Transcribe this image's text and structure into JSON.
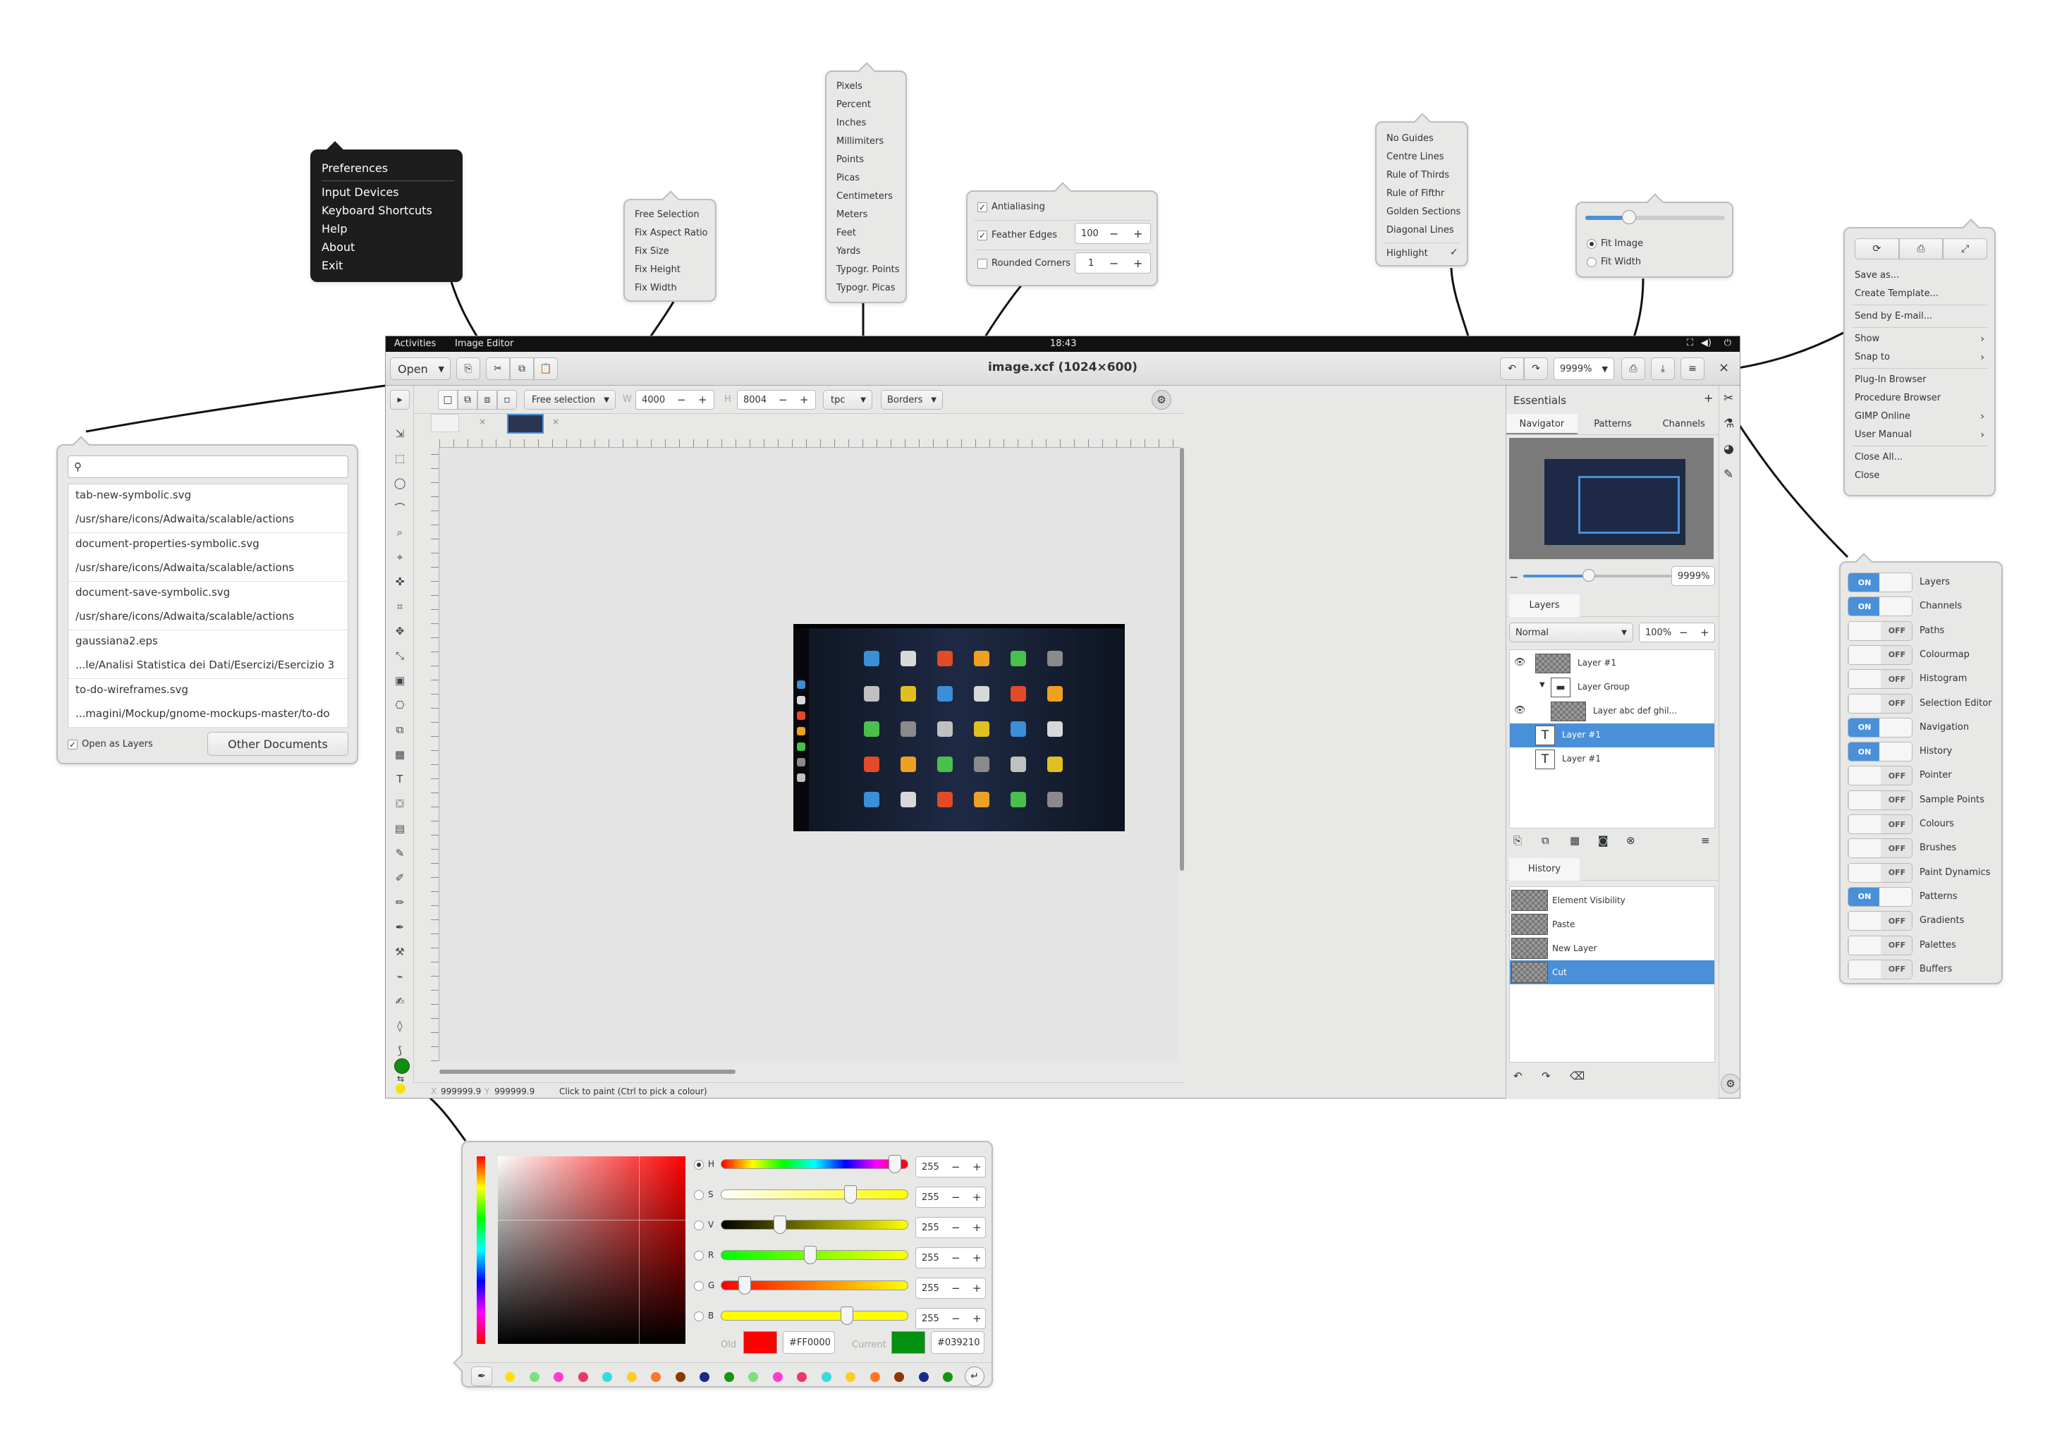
{
  "topbar": {
    "activities": "Activities",
    "app": "Image Editor",
    "clock": "18:43"
  },
  "titlebar": {
    "open_label": "Open",
    "title": "image.xcf (1024×600)",
    "zoom_value": "9999%"
  },
  "toolopts": {
    "selection_mode": "Free selection",
    "w_label": "W",
    "w_value": "4000",
    "h_label": "H",
    "h_value": "8004",
    "unit": "tpc",
    "borders": "Borders"
  },
  "app_menu": {
    "items": [
      "Preferences",
      "Input Devices",
      "Keyboard Shortcuts",
      "Help",
      "About",
      "Exit"
    ]
  },
  "selection_menu": {
    "items": [
      "Free Selection",
      "Fix Aspect Ratio",
      "Fix Size",
      "Fix Height",
      "Fix Width"
    ]
  },
  "unit_menu": {
    "items": [
      "Pixels",
      "Percent",
      "Inches",
      "Millimiters",
      "Points",
      "Picas",
      "Centimeters",
      "Meters",
      "Feet",
      "Yards",
      "Typogr. Points",
      "Typogr. Picas"
    ]
  },
  "borders_popover": {
    "antialiasing": "Antialiasing",
    "feather_label": "Feather Edges",
    "feather_value": "100",
    "rounded_label": "Rounded Corners",
    "rounded_value": "1"
  },
  "guides_menu": {
    "items": [
      "No Guides",
      "Centre Lines",
      "Rule of Thirds",
      "Rule of Fifthr",
      "Golden Sections",
      "Diagonal Lines"
    ],
    "highlight": "Highlight"
  },
  "zoom_popover": {
    "fit_image": "Fit Image",
    "fit_width": "Fit Width"
  },
  "image_menu": {
    "items": [
      "Save as...",
      "Create Template...",
      "Send by E-mail...",
      "Show",
      "Snap to",
      "Plug-In Browser",
      "Procedure Browser",
      "GIMP Online",
      "User Manual",
      "Close All...",
      "Close"
    ],
    "submenu_arrow": "›"
  },
  "docks_popover": {
    "on": "ON",
    "off": "OFF",
    "items": [
      {
        "label": "Layers",
        "state": "on"
      },
      {
        "label": "Channels",
        "state": "on"
      },
      {
        "label": "Paths",
        "state": "off"
      },
      {
        "label": "Colourmap",
        "state": "off"
      },
      {
        "label": "Histogram",
        "state": "off"
      },
      {
        "label": "Selection Editor",
        "state": "off"
      },
      {
        "label": "Navigation",
        "state": "on"
      },
      {
        "label": "History",
        "state": "on"
      },
      {
        "label": "Pointer",
        "state": "off"
      },
      {
        "label": "Sample Points",
        "state": "off"
      },
      {
        "label": "Colours",
        "state": "off"
      },
      {
        "label": "Brushes",
        "state": "off"
      },
      {
        "label": "Paint Dynamics",
        "state": "off"
      },
      {
        "label": "Patterns",
        "state": "on"
      },
      {
        "label": "Gradients",
        "state": "off"
      },
      {
        "label": "Palettes",
        "state": "off"
      },
      {
        "label": "Buffers",
        "state": "off"
      }
    ]
  },
  "open_popover": {
    "recent": [
      {
        "name": "tab-new-symbolic.svg",
        "path": "/usr/share/icons/Adwaita/scalable/actions"
      },
      {
        "name": "document-properties-symbolic.svg",
        "path": "/usr/share/icons/Adwaita/scalable/actions"
      },
      {
        "name": "document-save-symbolic.svg",
        "path": "/usr/share/icons/Adwaita/scalable/actions"
      },
      {
        "name": "gaussiana2.eps",
        "path": "...le/Analisi Statistica dei Dati/Esercizi/Esercizio 3"
      },
      {
        "name": "to-do-wireframes.svg",
        "path": "...magini/Mockup/gnome-mockups-master/to-do"
      }
    ],
    "open_as_layers": "Open as Layers",
    "other_documents": "Other Documents"
  },
  "dock": {
    "title": "Essentials",
    "tabs": [
      "Navigator",
      "Patterns",
      "Channels"
    ],
    "nav_zoom": "9999%",
    "layers_tab": "Layers",
    "blend_mode": "Normal",
    "opacity": "100%",
    "layers": [
      {
        "name": "Layer #1",
        "visible": true,
        "indent": 0,
        "type": "thumb",
        "selected": false
      },
      {
        "name": "Layer Group",
        "visible": false,
        "indent": 1,
        "type": "group",
        "selected": false
      },
      {
        "name": "Layer abc def ghil...",
        "visible": true,
        "indent": 1,
        "type": "thumb",
        "selected": false
      },
      {
        "name": "Layer #1",
        "visible": false,
        "indent": 0,
        "type": "text",
        "selected": true
      },
      {
        "name": "Layer #1",
        "visible": false,
        "indent": 0,
        "type": "text",
        "selected": false
      }
    ],
    "history_tab": "History",
    "history": [
      {
        "name": "Element Visibility",
        "selected": false
      },
      {
        "name": "Paste",
        "selected": false
      },
      {
        "name": "New Layer",
        "selected": false
      },
      {
        "name": "Cut",
        "selected": true
      }
    ]
  },
  "statusbar": {
    "x_label": "X",
    "x_value": "999999.9",
    "y_label": "Y",
    "y_value": "999999.9",
    "hint": "Click to paint (Ctrl to pick a colour)"
  },
  "color_popover": {
    "channels": [
      {
        "label": "H",
        "value": "255",
        "selected": true
      },
      {
        "label": "S",
        "value": "255",
        "selected": false
      },
      {
        "label": "V",
        "value": "255",
        "selected": false
      },
      {
        "label": "R",
        "value": "255",
        "selected": false
      },
      {
        "label": "G",
        "value": "255",
        "selected": false
      },
      {
        "label": "B",
        "value": "255",
        "selected": false
      }
    ],
    "old_label": "Old",
    "old_hex": "#FF0000",
    "current_label": "Current",
    "current_hex": "#039210",
    "swatches": [
      "#ffe000",
      "#7de07d",
      "#ff3ed0",
      "#e83a6a",
      "#34dcdc",
      "#ffcc22",
      "#ff7722",
      "#8a3a00",
      "#1a2a8a",
      "#129612",
      "#7de07d",
      "#ff3ed0",
      "#e83a6a",
      "#34dcdc",
      "#ffcc22",
      "#ff7722",
      "#8a3a00",
      "#1a2a8a",
      "#129612"
    ]
  },
  "colors": {
    "accent": "#4a90d9",
    "fg_color": "#108e10",
    "bg_color": "#f4e400",
    "topbar": "#111111"
  }
}
